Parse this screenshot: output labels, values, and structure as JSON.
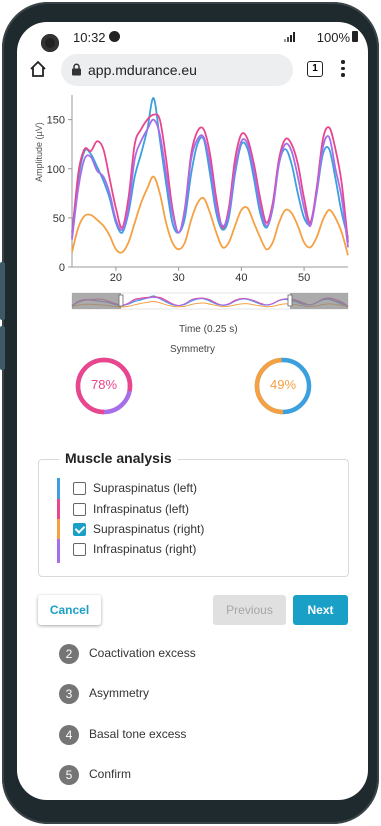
{
  "status_bar": {
    "time": "10:32",
    "battery": "100%"
  },
  "browser": {
    "url": "app.mdurance.eu",
    "tab_count": "1"
  },
  "chart_data": {
    "type": "line",
    "xlabel": "Time (0.25 s)",
    "ylabel": "Amplitude (µV)",
    "xlim": [
      13,
      57
    ],
    "ylim": [
      0,
      170
    ],
    "x_ticks": [
      "20",
      "30",
      "40",
      "50"
    ],
    "y_ticks": [
      "0",
      "50",
      "100",
      "150"
    ],
    "series": [
      {
        "name": "Supraspinatus (left)",
        "color": "#3ba0dd",
        "x": [
          13,
          14,
          15,
          16,
          17,
          18,
          19,
          20,
          21,
          22,
          23,
          24,
          25,
          26,
          27,
          28,
          29,
          30,
          31,
          32,
          33,
          34,
          35,
          36,
          37,
          38,
          39,
          40,
          41,
          42,
          43,
          44,
          45,
          46,
          47,
          48,
          49,
          50,
          51,
          52,
          53,
          54,
          55,
          56,
          57
        ],
        "y": [
          35,
          90,
          118,
          115,
          102,
          88,
          70,
          45,
          35,
          55,
          92,
          115,
          140,
          172,
          130,
          85,
          45,
          35,
          50,
          95,
          125,
          130,
          95,
          55,
          38,
          50,
          95,
          125,
          120,
          90,
          55,
          40,
          60,
          105,
          120,
          105,
          75,
          50,
          45,
          75,
          115,
          120,
          90,
          55,
          30
        ]
      },
      {
        "name": "Infraspinatus (left)",
        "color": "#e8468d",
        "x": [
          13,
          14,
          15,
          16,
          17,
          18,
          19,
          20,
          21,
          22,
          23,
          24,
          25,
          26,
          27,
          28,
          29,
          30,
          31,
          32,
          33,
          34,
          35,
          36,
          37,
          38,
          39,
          40,
          41,
          42,
          43,
          44,
          45,
          46,
          47,
          48,
          49,
          50,
          51,
          52,
          53,
          54,
          55,
          56,
          57
        ],
        "y": [
          30,
          95,
          120,
          118,
          128,
          120,
          90,
          60,
          40,
          70,
          125,
          140,
          150,
          155,
          150,
          110,
          60,
          35,
          60,
          115,
          138,
          140,
          115,
          70,
          40,
          60,
          110,
          135,
          130,
          105,
          70,
          45,
          65,
          110,
          130,
          125,
          105,
          70,
          45,
          80,
          130,
          142,
          120,
          85,
          25
        ]
      },
      {
        "name": "Supraspinatus (right)",
        "color": "#f5a042",
        "x": [
          13,
          14,
          15,
          16,
          17,
          18,
          19,
          20,
          21,
          22,
          23,
          24,
          25,
          26,
          27,
          28,
          29,
          30,
          31,
          32,
          33,
          34,
          35,
          36,
          37,
          38,
          39,
          40,
          41,
          42,
          43,
          44,
          45,
          46,
          47,
          48,
          49,
          50,
          51,
          52,
          53,
          54,
          55,
          56,
          57
        ],
        "y": [
          15,
          40,
          52,
          53,
          48,
          42,
          32,
          18,
          15,
          25,
          45,
          65,
          80,
          92,
          75,
          45,
          25,
          18,
          25,
          48,
          65,
          70,
          55,
          35,
          20,
          25,
          42,
          58,
          60,
          45,
          30,
          18,
          25,
          45,
          58,
          55,
          42,
          25,
          20,
          30,
          48,
          58,
          50,
          35,
          12
        ]
      },
      {
        "name": "Infraspinatus (right)",
        "color": "#a66ee8",
        "x": [
          13,
          14,
          15,
          16,
          17,
          18,
          19,
          20,
          21,
          22,
          23,
          24,
          25,
          26,
          27,
          28,
          29,
          30,
          31,
          32,
          33,
          34,
          35,
          36,
          37,
          38,
          39,
          40,
          41,
          42,
          43,
          44,
          45,
          46,
          47,
          48,
          49,
          50,
          51,
          52,
          53,
          54,
          55,
          56,
          57
        ],
        "y": [
          28,
          80,
          110,
          112,
          98,
          92,
          75,
          48,
          38,
          60,
          110,
          128,
          140,
          150,
          135,
          95,
          55,
          35,
          58,
          110,
          130,
          132,
          105,
          62,
          42,
          55,
          100,
          128,
          125,
          98,
          62,
          42,
          60,
          105,
          125,
          118,
          92,
          60,
          42,
          75,
          122,
          132,
          100,
          70,
          20
        ]
      }
    ]
  },
  "symmetry": {
    "title": "Symmetry",
    "left": {
      "value": "78%",
      "fraction": 0.78,
      "color": "#e8468d",
      "track": "#a66ee8"
    },
    "right": {
      "value": "49%",
      "fraction": 0.49,
      "color": "#f5a042",
      "track": "#3ba0dd"
    }
  },
  "muscle_analysis": {
    "title": "Muscle analysis",
    "items": [
      {
        "label": "Supraspinatus (left)",
        "color": "#3ba0dd",
        "checked": false
      },
      {
        "label": "Infraspinatus (left)",
        "color": "#e8468d",
        "checked": false
      },
      {
        "label": "Supraspinatus (right)",
        "color": "#f5a042",
        "checked": true
      },
      {
        "label": "Infraspinatus (right)",
        "color": "#a66ee8",
        "checked": false
      }
    ]
  },
  "actions": {
    "cancel": "Cancel",
    "previous": "Previous",
    "next": "Next"
  },
  "steps": [
    {
      "number": "2",
      "label": "Coactivation excess"
    },
    {
      "number": "3",
      "label": "Asymmetry"
    },
    {
      "number": "4",
      "label": "Basal tone excess"
    },
    {
      "number": "5",
      "label": "Confirm"
    }
  ]
}
